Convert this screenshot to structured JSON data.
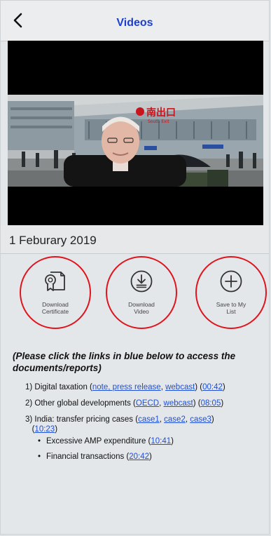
{
  "nav": {
    "title": "Videos",
    "back_icon": "chevron-left-icon"
  },
  "video": {
    "sign_cn": "南出口",
    "sign_en": "South Exit"
  },
  "date": "1 Feburary 2019",
  "actions": [
    {
      "icon": "certificate-icon",
      "line1": "Download",
      "line2": "Certificate"
    },
    {
      "icon": "download-icon",
      "line1": "Download",
      "line2": "Video"
    },
    {
      "icon": "plus-circle-icon",
      "line1": "Save to My",
      "line2": "List"
    }
  ],
  "colors": {
    "title": "#1e3fcc",
    "link": "#1f4fd6",
    "highlight_circle": "#e0141c"
  },
  "instruction": "(Please click the links in blue below to access the documents/reports)",
  "items": [
    {
      "num": "1) ",
      "text": "Digital taxation (",
      "links": [
        "note, press release",
        "webcast"
      ],
      "time": "00:42"
    },
    {
      "num": "2) ",
      "text": "Other global developments (",
      "links": [
        "OECD",
        "webcast"
      ],
      "time": "08:05"
    },
    {
      "num": "3) ",
      "text": "India: transfer pricing cases (",
      "links": [
        "case1",
        "case2",
        "case3"
      ],
      "time": "10:23"
    }
  ],
  "subitems": [
    {
      "text": "Excessive AMP expenditure (",
      "time": "10:41"
    },
    {
      "text": "Financial transactions (",
      "time": "20:42"
    }
  ]
}
